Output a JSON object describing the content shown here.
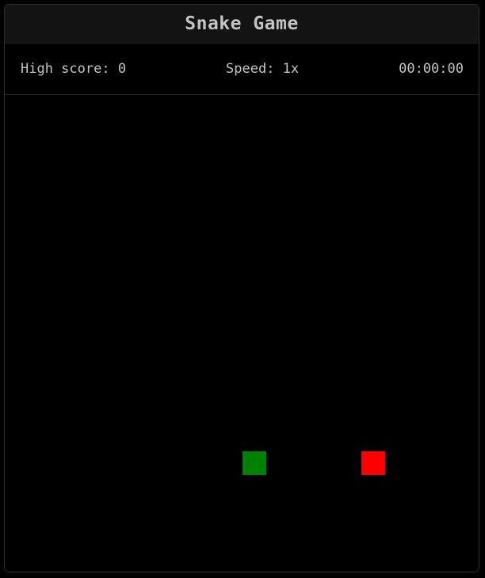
{
  "header": {
    "title": "Snake Game"
  },
  "status": {
    "high_score": "High score: 0",
    "speed": "Speed: 1x",
    "timer": "00:00:00"
  },
  "colors": {
    "snake": "#008000",
    "food": "#ff0000"
  }
}
